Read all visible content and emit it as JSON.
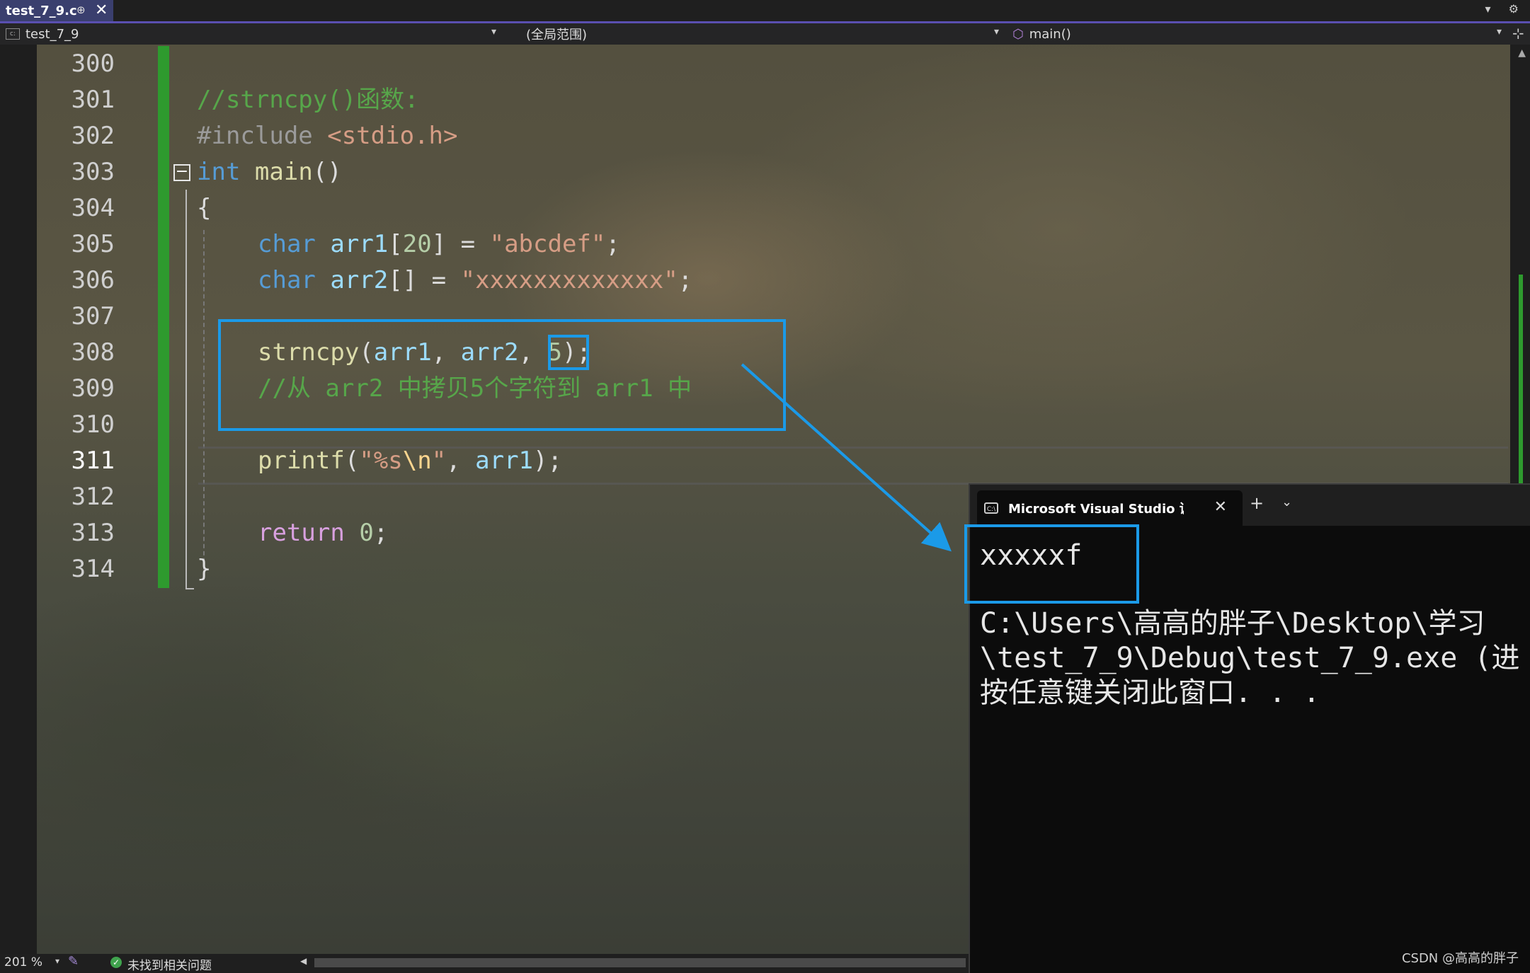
{
  "tab": {
    "title": "test_7_9.c",
    "pin": "⊕",
    "close": "✕"
  },
  "strip_icons": "▾ ⚙",
  "navbar": {
    "project": "test_7_9",
    "scope": "(全局范围)",
    "member": "main()"
  },
  "lines": [
    {
      "num": "300"
    },
    {
      "num": "301"
    },
    {
      "num": "302"
    },
    {
      "num": "303"
    },
    {
      "num": "304"
    },
    {
      "num": "305"
    },
    {
      "num": "306"
    },
    {
      "num": "307"
    },
    {
      "num": "308"
    },
    {
      "num": "309"
    },
    {
      "num": "310"
    },
    {
      "num": "311"
    },
    {
      "num": "312"
    },
    {
      "num": "313"
    },
    {
      "num": "314"
    }
  ],
  "code": {
    "l301": "//strncpy()函数:",
    "l302_pre": "#include ",
    "l302_hdr": "<stdio.h>",
    "l303_kw": "int",
    "l303_fn": "main",
    "l303_rest": "()",
    "l304": "{",
    "l305_kw": "char",
    "l305_id": "arr1",
    "l305_a": "[",
    "l305_num": "20",
    "l305_b": "] = ",
    "l305_str": "\"abcdef\"",
    "l305_end": ";",
    "l306_kw": "char",
    "l306_id": "arr2",
    "l306_a": "[] = ",
    "l306_str": "\"xxxxxxxxxxxxx\"",
    "l306_end": ";",
    "l308_fn": "strncpy",
    "l308_a": "(",
    "l308_id1": "arr1",
    "l308_b": ", ",
    "l308_id2": "arr2",
    "l308_c": ", ",
    "l308_num": "5",
    "l308_end": ");",
    "l309": "//从 arr2 中拷贝5个字符到 arr1 中",
    "l311_fn": "printf",
    "l311_a": "(",
    "l311_s1": "\"%s",
    "l311_esc": "\\n",
    "l311_s2": "\"",
    "l311_b": ", ",
    "l311_id": "arr1",
    "l311_end": ");",
    "l313_kw": "return",
    "l313_num": "0",
    "l313_end": ";",
    "l314": "}"
  },
  "console": {
    "title": "Microsoft Visual Studio 调试控制台",
    "plus": "+",
    "chevron": "⌄",
    "close": "✕",
    "output": "xxxxxf",
    "path1": "C:\\Users\\高高的胖子\\Desktop\\学习",
    "path2": "\\test_7_9\\Debug\\test_7_9.exe (进",
    "path3": "按任意键关闭此窗口. . ."
  },
  "status": {
    "zoom": "201 %",
    "issues": "未找到相关问题"
  },
  "watermark": "CSDN @高高的胖子",
  "colors": {
    "accent": "#1b9ae8",
    "change_bar": "#2e9a2e",
    "comment": "#57a64a",
    "keyword": "#569cd6"
  }
}
